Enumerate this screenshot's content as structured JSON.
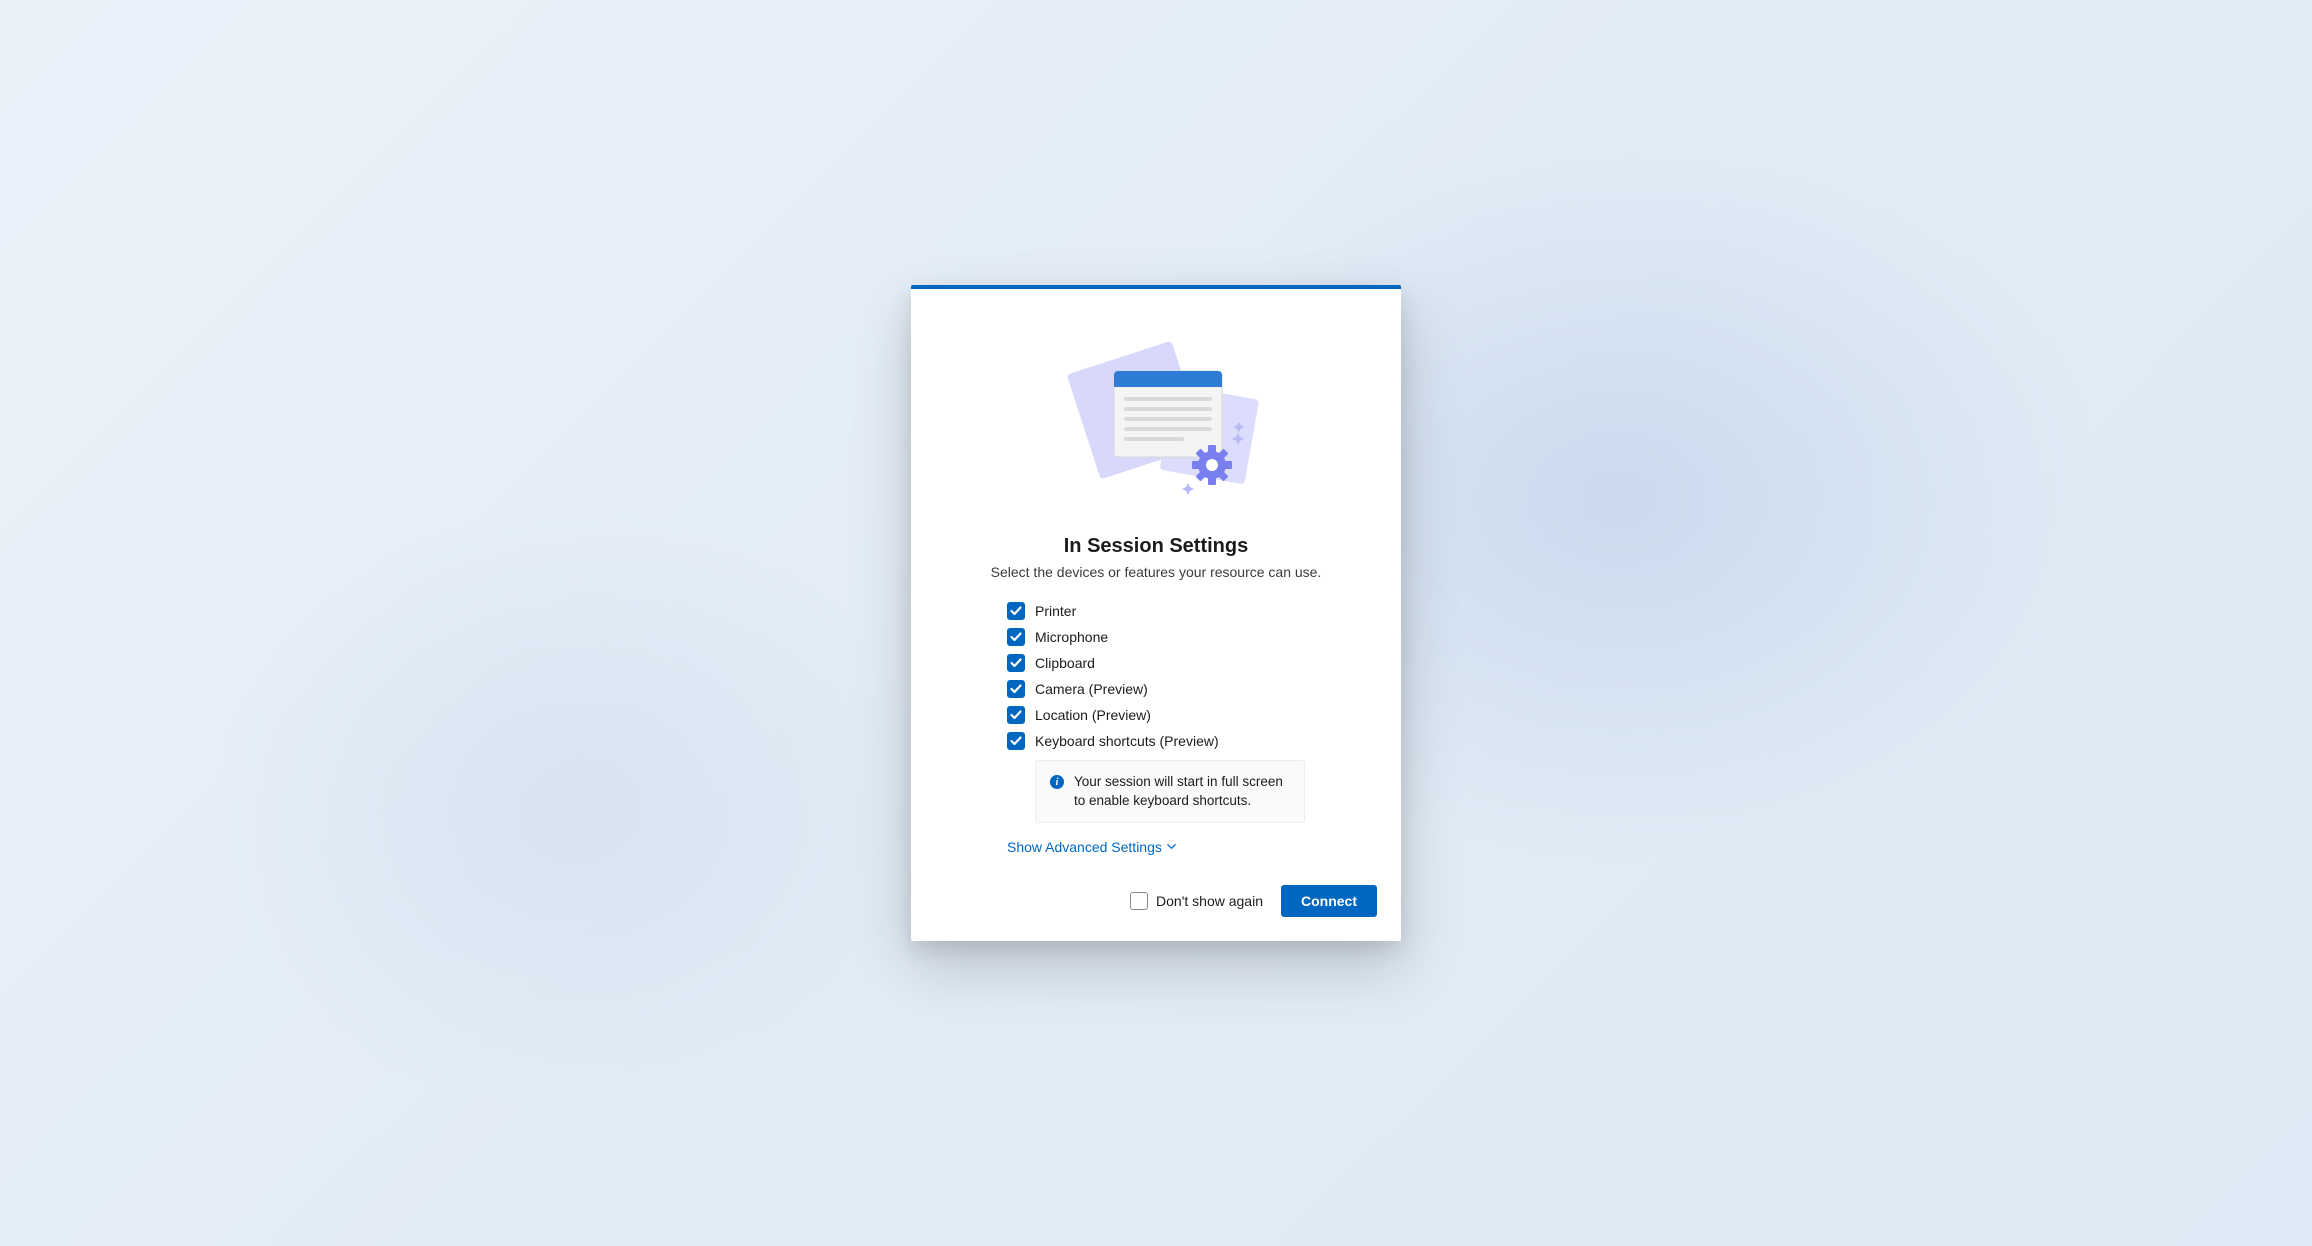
{
  "dialog": {
    "title": "In Session Settings",
    "subtitle": "Select the devices or features your resource can use."
  },
  "options": [
    {
      "id": "printer",
      "label": "Printer",
      "checked": true
    },
    {
      "id": "mic",
      "label": "Microphone",
      "checked": true
    },
    {
      "id": "clipboard",
      "label": "Clipboard",
      "checked": true
    },
    {
      "id": "camera",
      "label": "Camera (Preview)",
      "checked": true
    },
    {
      "id": "location",
      "label": "Location (Preview)",
      "checked": true
    },
    {
      "id": "keyboard",
      "label": "Keyboard shortcuts (Preview)",
      "checked": true
    }
  ],
  "info": {
    "text": "Your session will start in full screen to enable keyboard shortcuts."
  },
  "advanced": {
    "label": "Show Advanced Settings"
  },
  "footer": {
    "dont_show_label": "Don't show again",
    "dont_show_checked": false,
    "connect_label": "Connect"
  },
  "colors": {
    "accent": "#0067c0"
  }
}
